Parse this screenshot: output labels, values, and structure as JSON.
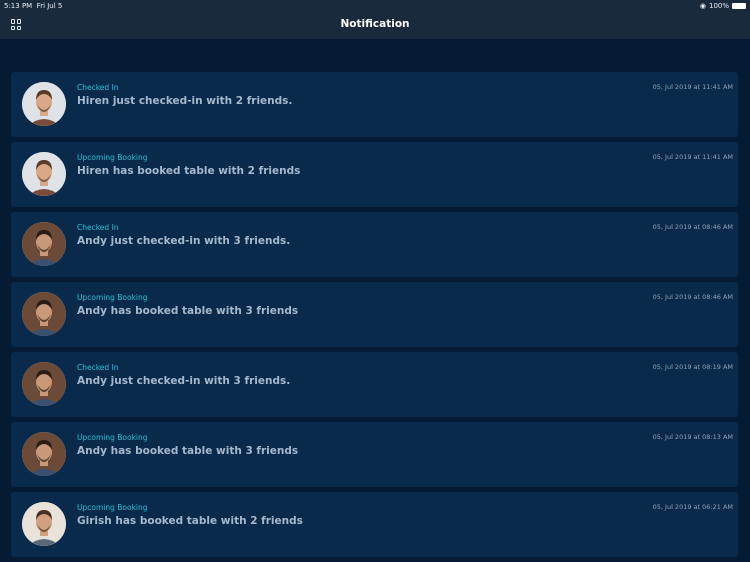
{
  "status_bar": {
    "time": "5:13 PM",
    "date": "Fri Jul 5",
    "battery": "100%"
  },
  "header": {
    "title": "Notification"
  },
  "notifications": [
    {
      "category": "Checked In",
      "message": "Hiren just checked-in with 2 friends.",
      "timestamp": "05, Jul 2019 at 11:41 AM",
      "avatar": "hiren"
    },
    {
      "category": "Upcoming Booking",
      "message": "Hiren has booked table with 2 friends",
      "timestamp": "05, Jul 2019 at 11:41 AM",
      "avatar": "hiren"
    },
    {
      "category": "Checked In",
      "message": "Andy just checked-in with 3 friends.",
      "timestamp": "05, Jul 2019 at 08:46 AM",
      "avatar": "andy"
    },
    {
      "category": "Upcoming Booking",
      "message": "Andy has booked table with 3 friends",
      "timestamp": "05, Jul 2019 at 08:46 AM",
      "avatar": "andy"
    },
    {
      "category": "Checked In",
      "message": "Andy just checked-in with 3 friends.",
      "timestamp": "05, Jul 2019 at 08:19 AM",
      "avatar": "andy"
    },
    {
      "category": "Upcoming Booking",
      "message": "Andy has booked table with 3 friends",
      "timestamp": "05, Jul 2019 at 08:13 AM",
      "avatar": "andy"
    },
    {
      "category": "Upcoming Booking",
      "message": "Girish has booked table with 2 friends",
      "timestamp": "05, Jul 2019 at 06:21 AM",
      "avatar": "girish"
    }
  ]
}
